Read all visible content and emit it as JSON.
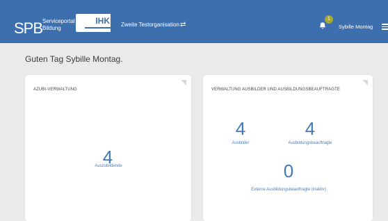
{
  "header": {
    "brand_logo": "SPB",
    "brand_line1": "Serviceportal",
    "brand_line2": "Bildung",
    "chamber_label": "IHK",
    "organisation": "Zweite Testorganisation",
    "notification_count": "1",
    "user_name": "Sybille Montag",
    "colors": {
      "header_bg": "#3d6fae",
      "badge": "#a9a832"
    }
  },
  "greeting": "Guten Tag Sybille Montag.",
  "cards": [
    {
      "title": "AZUBI-VERWALTUNG",
      "metrics": [
        {
          "value": "4",
          "label": "Auszubildende"
        }
      ]
    },
    {
      "title": "VERWALTUNG AUSBILDER UND AUSBILDUNGSBEAUFTRAGTE",
      "metrics": [
        {
          "value": "4",
          "label": "Ausbilder"
        },
        {
          "value": "4",
          "label": "Ausbildungsbeauftragte"
        },
        {
          "value": "0",
          "label": "Externe Ausbildungsbeauftragte (inaktiv)"
        }
      ]
    }
  ]
}
